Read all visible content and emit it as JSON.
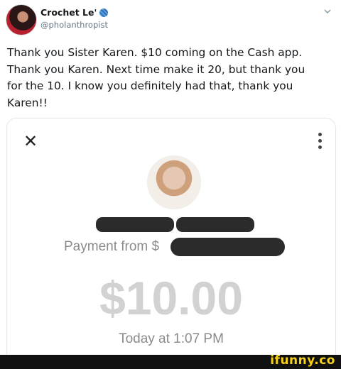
{
  "tweet": {
    "display_name": "Crochet Le'",
    "handle": "@pholanthropist",
    "text": "Thank you Sister Karen. $10 coming on the Cash app.\nThank you Karen. Next time make it 20, but thank you\nfor the 10. I know you definitely had that, thank you\nKaren!!"
  },
  "icons": {
    "close": "close-icon",
    "more": "more-vertical-icon",
    "chevron": "chevron-down-icon",
    "yarn": "yarn-ball-icon"
  },
  "payment_card": {
    "payment_from": "Payment from $",
    "amount": "$10.00",
    "date": "Today at 1:07 PM"
  },
  "watermark": "ifunny.co",
  "colors": {
    "muted_text": "#8b8b8b",
    "amount_text": "#d2d2d2",
    "redaction": "#2b2b2b",
    "watermark": "#f7d118"
  }
}
